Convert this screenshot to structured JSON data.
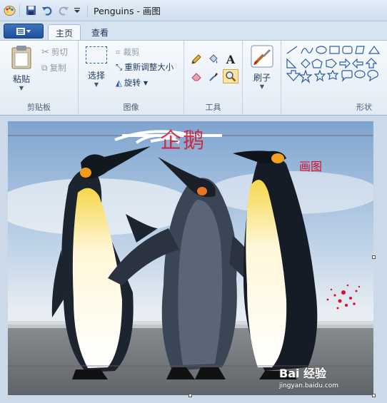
{
  "window": {
    "title": "Penguins - 画图"
  },
  "tabs": {
    "home": "主页",
    "view": "查看"
  },
  "clipboard": {
    "paste": "粘贴",
    "cut": "剪切",
    "copy": "复制",
    "label": "剪贴板"
  },
  "image": {
    "select": "选择",
    "crop": "裁剪",
    "resize": "重新调整大小",
    "rotate": "旋转",
    "label": "图像"
  },
  "tools": {
    "label": "工具",
    "brushes": "刷子"
  },
  "shapes": {
    "label": "形状"
  },
  "canvas": {
    "handwritten_text": "企鹅",
    "red_text": "画图",
    "watermark": "Bai 经验",
    "watermark_url": "jingyan.baidu.com"
  },
  "colors": {
    "accent": "#2b5797",
    "red_paint": "#d8102a"
  }
}
